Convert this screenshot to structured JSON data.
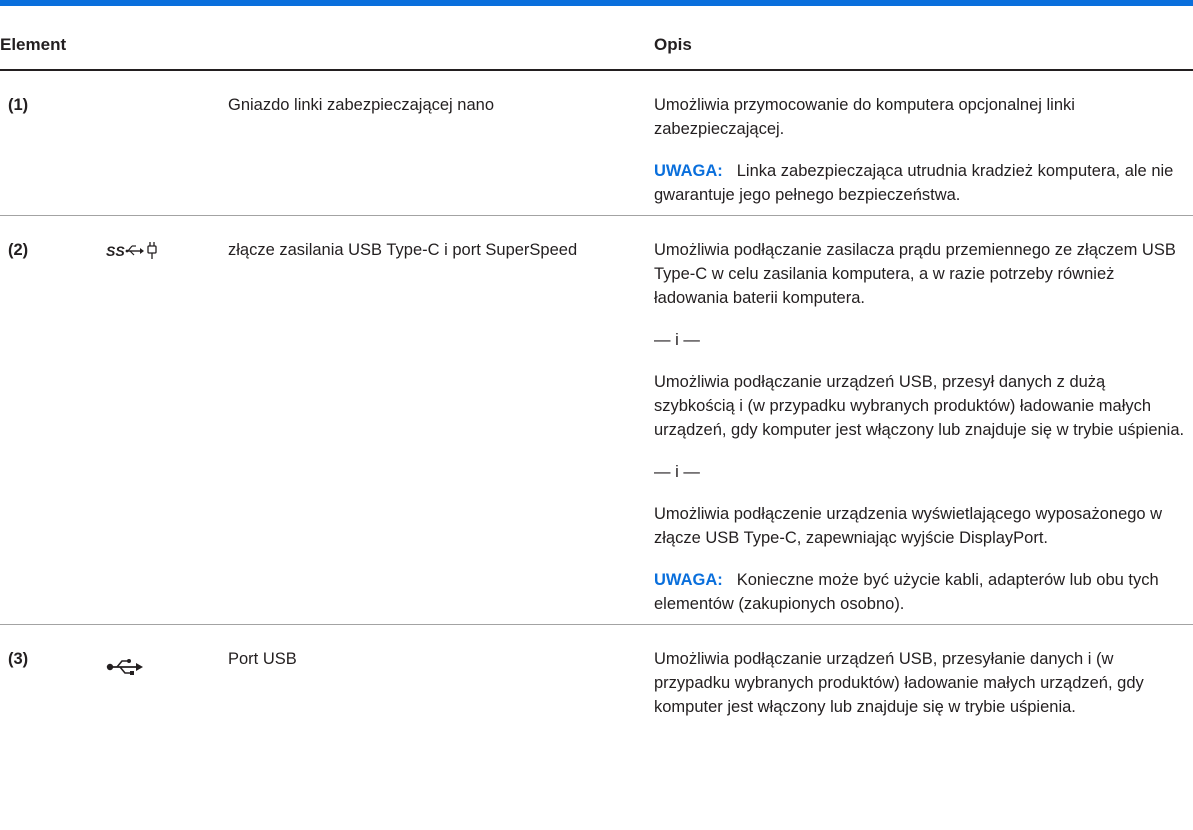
{
  "table": {
    "headers": {
      "element": "Element",
      "description": "Opis"
    },
    "rows": [
      {
        "number": "(1)",
        "icon": "",
        "name": "Gniazdo linki zabezpieczającej nano",
        "description": [
          {
            "type": "text",
            "text": "Umożliwia przymocowanie do komputera opcjonalnej linki zabezpieczającej."
          },
          {
            "type": "note",
            "label": "UWAGA:",
            "text": "Linka zabezpieczająca utrudnia kradzież komputera, ale nie gwarantuje jego pełnego bezpieczeństwa."
          }
        ]
      },
      {
        "number": "(2)",
        "icon": "superspeed-usb-power-icon",
        "name": "złącze zasilania USB Type-C i port SuperSpeed",
        "description": [
          {
            "type": "text",
            "text": "Umożliwia podłączanie zasilacza prądu przemiennego ze złączem USB Type-C w celu zasilania komputera, a w razie potrzeby również ładowania baterii komputera."
          },
          {
            "type": "sep",
            "text": "— i —"
          },
          {
            "type": "text",
            "text": "Umożliwia podłączanie urządzeń USB, przesył danych z dużą szybkością i (w przypadku wybranych produktów) ładowanie małych urządzeń, gdy komputer jest włączony lub znajduje się w trybie uśpienia."
          },
          {
            "type": "sep",
            "text": "— i —"
          },
          {
            "type": "text",
            "text": "Umożliwia podłączenie urządzenia wyświetlającego wyposażonego w złącze USB Type-C, zapewniając wyjście DisplayPort."
          },
          {
            "type": "note",
            "label": "UWAGA:",
            "text": "Konieczne może być użycie kabli, adapterów lub obu tych elementów (zakupionych osobno)."
          }
        ]
      },
      {
        "number": "(3)",
        "icon": "usb-icon",
        "name": "Port USB",
        "description": [
          {
            "type": "text",
            "text": "Umożliwia podłączanie urządzeń USB, przesyłanie danych i (w przypadku wybranych produktów) ładowanie małych urządzeń, gdy komputer jest włączony lub znajduje się w trybie uśpienia."
          }
        ]
      }
    ]
  },
  "colors": {
    "accent": "#0a6fdc",
    "text": "#231f20",
    "rule": "#a3a3a3"
  }
}
